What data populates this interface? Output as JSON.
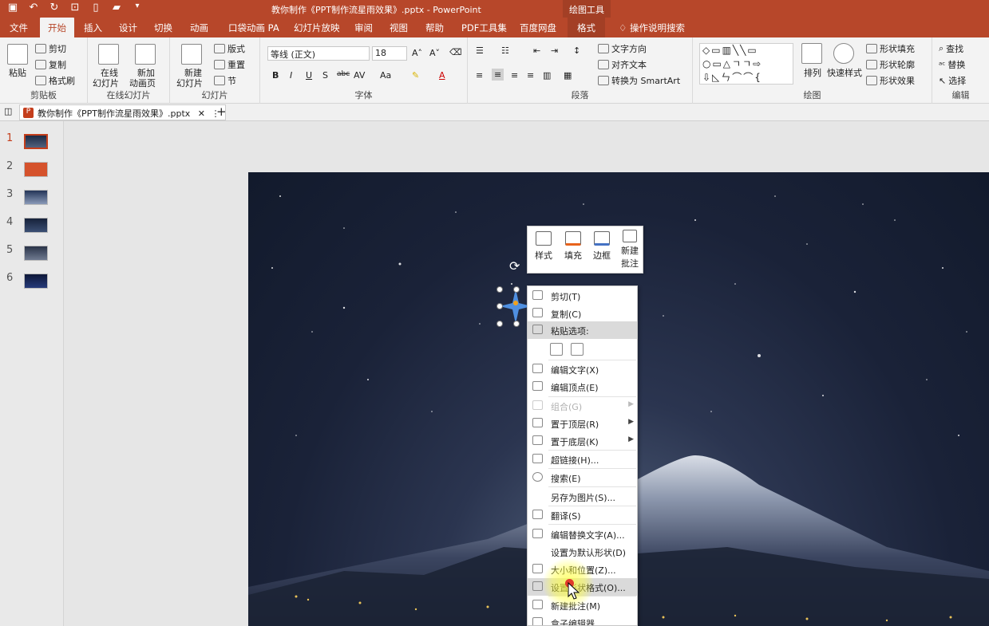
{
  "window": {
    "title": "教你制作《PPT制作流星雨效果》.pptx  -  PowerPoint",
    "tools_tab": "绘图工具"
  },
  "tabs": [
    {
      "label": "文件"
    },
    {
      "label": "开始"
    },
    {
      "label": "插入"
    },
    {
      "label": "设计"
    },
    {
      "label": "切换"
    },
    {
      "label": "动画"
    },
    {
      "label": "口袋动画 PA"
    },
    {
      "label": "幻灯片放映"
    },
    {
      "label": "审阅"
    },
    {
      "label": "视图"
    },
    {
      "label": "帮助"
    },
    {
      "label": "PDF工具集"
    },
    {
      "label": "百度网盘"
    },
    {
      "label": "格式"
    },
    {
      "label": "操作说明搜索"
    }
  ],
  "ribbon": {
    "clipboard": {
      "label": "剪贴板",
      "paste": "粘贴",
      "cut": "剪切",
      "copy": "复制",
      "format_painter": "格式刷"
    },
    "online": {
      "label": "在线幻灯片",
      "online_slide_1": "在线",
      "online_slide_2": "幻灯片",
      "new_anim_1": "新加",
      "new_anim_2": "动画页"
    },
    "slides": {
      "label": "幻灯片",
      "new_1": "新建",
      "new_2": "幻灯片",
      "layout": "版式",
      "reset": "重置",
      "section": "节"
    },
    "font": {
      "label": "字体",
      "font_name": "等线 (正文)",
      "font_size": "18"
    },
    "paragraph": {
      "label": "段落",
      "text_direction": "文字方向",
      "align_text": "对齐文本",
      "smartart": "转换为 SmartArt"
    },
    "drawing": {
      "label": "绘图",
      "arrange": "排列",
      "quick_styles": "快速样式",
      "shape_fill": "形状填充",
      "shape_outline": "形状轮廓",
      "shape_effects": "形状效果"
    },
    "editing": {
      "label": "编辑",
      "find": "查找",
      "replace": "替换",
      "select": "选择"
    }
  },
  "doc_tab": {
    "title": "教你制作《PPT制作流星雨效果》.pptx"
  },
  "thumbnails": [
    "1",
    "2",
    "3",
    "4",
    "5",
    "6"
  ],
  "mini_toolbar": {
    "style": "样式",
    "fill": "填充",
    "border": "边框",
    "new_comment_1": "新建",
    "new_comment_2": "批注"
  },
  "context_menu": [
    {
      "label": "剪切(T)",
      "icon": "scissors-icon"
    },
    {
      "label": "复制(C)",
      "icon": "copy-icon"
    },
    {
      "label": "粘贴选项:",
      "icon": "paste-icon"
    },
    {
      "label": "",
      "icon": "paste-options-icon"
    },
    {
      "label": "编辑文字(X)",
      "icon": "edit-text-icon"
    },
    {
      "label": "编辑顶点(E)",
      "icon": "edit-points-icon"
    },
    {
      "label": "组合(G)",
      "icon": "group-icon"
    },
    {
      "label": "置于顶层(R)",
      "icon": "bring-front-icon"
    },
    {
      "label": "置于底层(K)",
      "icon": "send-back-icon"
    },
    {
      "label": "超链接(H)...",
      "icon": "link-icon"
    },
    {
      "label": "搜索(E)",
      "icon": "search-icon"
    },
    {
      "label": "另存为图片(S)...",
      "icon": ""
    },
    {
      "label": "翻译(S)",
      "icon": "translate-icon"
    },
    {
      "label": "编辑替换文字(A)...",
      "icon": "alt-text-icon"
    },
    {
      "label": "设置为默认形状(D)",
      "icon": ""
    },
    {
      "label": "大小和位置(Z)...",
      "icon": "size-position-icon"
    },
    {
      "label": "设置形状格式(O)...",
      "icon": "format-shape-icon"
    },
    {
      "label": "新建批注(M)",
      "icon": "comment-icon"
    },
    {
      "label": "盒子编辑器",
      "icon": "box-editor-icon"
    }
  ]
}
